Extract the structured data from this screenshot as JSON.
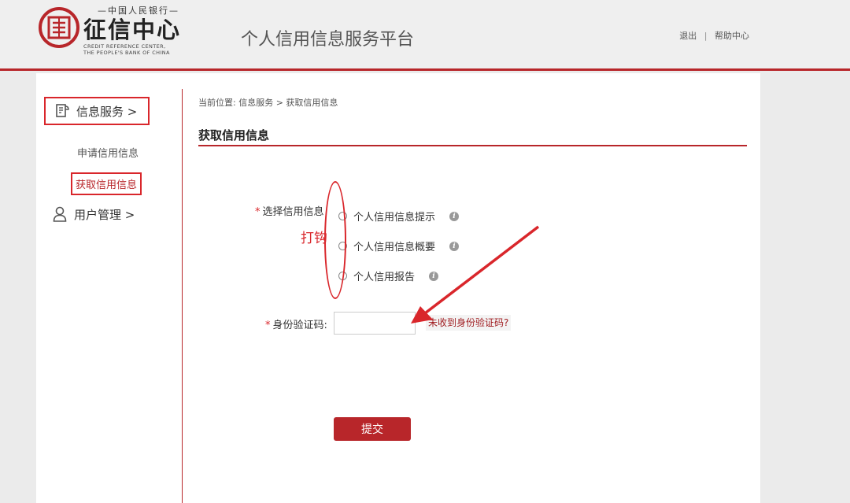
{
  "header": {
    "logo_top": "—中国人民银行—",
    "logo_main": "征信中心",
    "logo_en_line1": "CREDIT REFERENCE CENTER,",
    "logo_en_line2": "THE PEOPLE'S BANK OF CHINA",
    "platform_title": "个人信用信息服务平台",
    "links": {
      "logout": "退出",
      "separator": "|",
      "help": "帮助中心"
    }
  },
  "sidebar": {
    "groups": [
      {
        "label": "信息服务 >",
        "icon": "document-icon"
      },
      {
        "label": "用户管理 >",
        "icon": "user-icon"
      }
    ],
    "items": [
      {
        "label": "申请信用信息"
      },
      {
        "label": "获取信用信息"
      }
    ]
  },
  "main": {
    "breadcrumb": "当前位置: 信息服务 > 获取信用信息",
    "title": "获取信用信息",
    "select_label": "选择信用信息",
    "required_mark": "*",
    "options": [
      {
        "label": "个人信用信息提示",
        "selected": false
      },
      {
        "label": "个人信用信息概要",
        "selected": false
      },
      {
        "label": "个人信用报告",
        "selected": false
      }
    ],
    "code_label": "身份验证码:",
    "code_value": "",
    "resend_link": "未收到身份验证码?",
    "submit_label": "提交"
  },
  "annotations": {
    "tick_hint": "打钩"
  },
  "colors": {
    "brand_red": "#b8262a",
    "annotation_red": "#d9262b"
  }
}
